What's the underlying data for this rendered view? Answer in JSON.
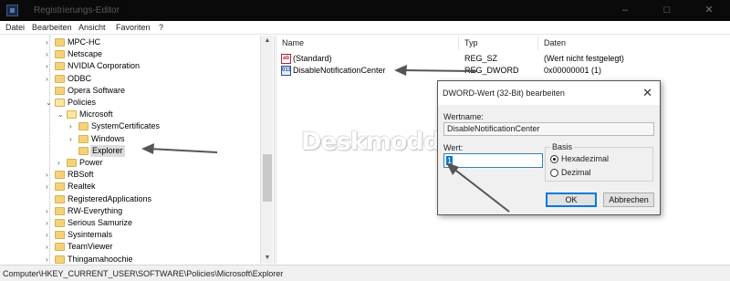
{
  "window": {
    "title": "Registrierungs-Editor",
    "controls": {
      "minimize": "–",
      "maximize": "□",
      "close": "✕"
    }
  },
  "menu": [
    "Datei",
    "Bearbeiten",
    "Ansicht",
    "Favoriten",
    "?"
  ],
  "tree": [
    {
      "label": "MPC-HC",
      "level": 1,
      "expander": "›"
    },
    {
      "label": "Netscape",
      "level": 1,
      "expander": "›"
    },
    {
      "label": "NVIDIA Corporation",
      "level": 1,
      "expander": "›"
    },
    {
      "label": "ODBC",
      "level": 1,
      "expander": "›"
    },
    {
      "label": "Opera Software",
      "level": 1,
      "expander": ""
    },
    {
      "label": "Policies",
      "level": 1,
      "expander": "⌄"
    },
    {
      "label": "Microsoft",
      "level": 2,
      "expander": "⌄"
    },
    {
      "label": "SystemCertificates",
      "level": 3,
      "expander": "›"
    },
    {
      "label": "Windows",
      "level": 3,
      "expander": "›"
    },
    {
      "label": "Explorer",
      "level": 3,
      "expander": "",
      "selected": true
    },
    {
      "label": "Power",
      "level": 2,
      "expander": "›"
    },
    {
      "label": "RBSoft",
      "level": 1,
      "expander": "›"
    },
    {
      "label": "Realtek",
      "level": 1,
      "expander": "›"
    },
    {
      "label": "RegisteredApplications",
      "level": 1,
      "expander": ""
    },
    {
      "label": "RW-Everything",
      "level": 1,
      "expander": "›"
    },
    {
      "label": "Serious Samurize",
      "level": 1,
      "expander": "›"
    },
    {
      "label": "Sysinternals",
      "level": 1,
      "expander": "›"
    },
    {
      "label": "TeamViewer",
      "level": 1,
      "expander": "›"
    },
    {
      "label": "Thingamahoochie",
      "level": 1,
      "expander": "›"
    }
  ],
  "list": {
    "columns": [
      "Name",
      "Typ",
      "Daten"
    ],
    "rows": [
      {
        "icon": "ab",
        "name": "(Standard)",
        "type": "REG_SZ",
        "data": "(Wert nicht festgelegt)"
      },
      {
        "icon": "011",
        "name": "DisableNotificationCenter",
        "type": "REG_DWORD",
        "data": "0x00000001 (1)"
      }
    ]
  },
  "watermark": "Deskmodder.de",
  "dialog": {
    "title": "DWORD-Wert (32-Bit) bearbeiten",
    "close": "✕",
    "name_label": "Wertname:",
    "name_value": "DisableNotificationCenter",
    "value_label": "Wert:",
    "value": "1",
    "base_label": "Basis",
    "radio_hex": "Hexadezimal",
    "radio_dec": "Dezimal",
    "selected_base": "Hexadezimal",
    "ok": "OK",
    "cancel": "Abbrechen"
  },
  "statusbar": {
    "path": "Computer\\HKEY_CURRENT_USER\\SOFTWARE\\Policies\\Microsoft\\Explorer"
  },
  "colors": {
    "titlebar": "#0a0a0a",
    "selection": "#0078d7",
    "folder": "#f3d27a",
    "arrow": "#555555"
  }
}
